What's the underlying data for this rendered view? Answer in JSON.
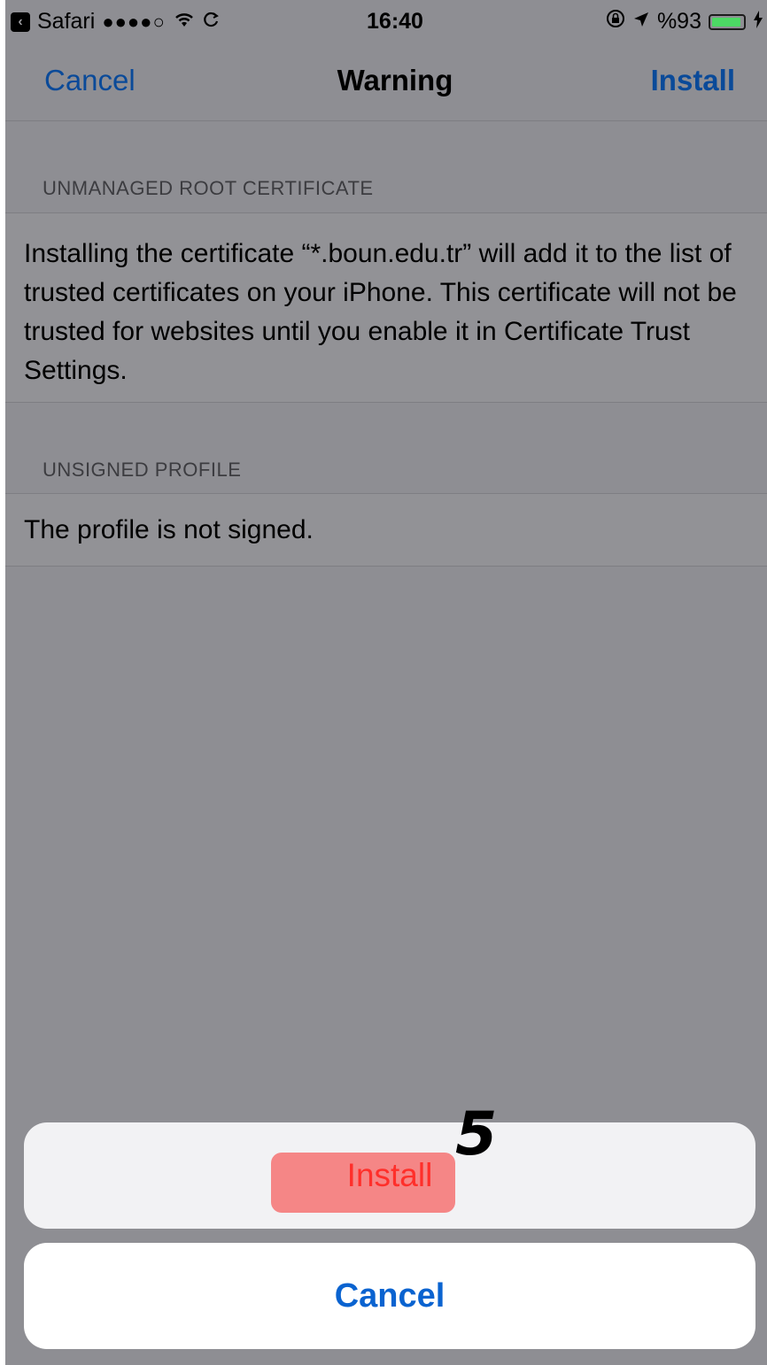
{
  "status_bar": {
    "back_app": "Safari",
    "signal_dots": "●●●●○",
    "time": "16:40",
    "battery_text": "%93",
    "battery_level": 0.93,
    "battery_color": "#4cd964"
  },
  "nav": {
    "cancel": "Cancel",
    "title": "Warning",
    "install": "Install"
  },
  "sections": [
    {
      "header": "UNMANAGED ROOT CERTIFICATE",
      "body": "Installing the certificate “*.boun.edu.tr” will add it to the list of trusted certificates on your iPhone. This certificate will not be trusted for websites until you enable it in Certificate Trust Settings."
    },
    {
      "header": "UNSIGNED PROFILE",
      "body": "The profile is not signed."
    }
  ],
  "action_sheet": {
    "install": "Install",
    "cancel": "Cancel",
    "step_number": "5",
    "install_color": "#ff2f2a",
    "cancel_color": "#0a63d0"
  }
}
